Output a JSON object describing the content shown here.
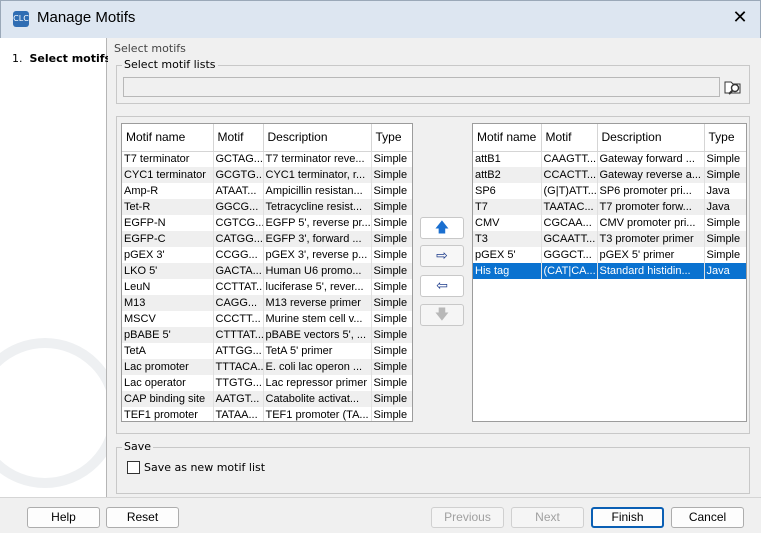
{
  "window": {
    "title": "Manage Motifs",
    "close": "✕",
    "app_icon": "CLC"
  },
  "steps": [
    {
      "num": "1.",
      "label": "Select motifs"
    }
  ],
  "section_title": "Select motifs",
  "motif_lists": {
    "label": "Select motif lists",
    "value": "",
    "browse_icon": "folder-search-icon"
  },
  "columns": [
    "Motif name",
    "Motif",
    "Description",
    "Type"
  ],
  "left_rows": [
    [
      "T7 terminator",
      "GCTAG...",
      "T7 terminator reve...",
      "Simple"
    ],
    [
      "CYC1 terminator",
      "GCGTG...",
      "CYC1 terminator, r...",
      "Simple"
    ],
    [
      "Amp-R",
      "ATAAT...",
      "Ampicillin resistan...",
      "Simple"
    ],
    [
      "Tet-R",
      "GGCG...",
      "Tetracycline resist...",
      "Simple"
    ],
    [
      "EGFP-N",
      "CGTCG...",
      "EGFP 5', reverse pr...",
      "Simple"
    ],
    [
      "EGFP-C",
      "CATGG...",
      "EGFP 3', forward ...",
      "Simple"
    ],
    [
      "pGEX 3'",
      "CCGG...",
      "pGEX 3', reverse p...",
      "Simple"
    ],
    [
      "LKO 5'",
      "GACTA...",
      "Human U6 promo...",
      "Simple"
    ],
    [
      "LeuN",
      "CCTTAT...",
      "luciferase 5', rever...",
      "Simple"
    ],
    [
      "M13",
      "CAGG...",
      "M13 reverse primer",
      "Simple"
    ],
    [
      "MSCV",
      "CCCTT...",
      "Murine stem cell v...",
      "Simple"
    ],
    [
      "pBABE 5'",
      "CTTTAT...",
      "pBABE vectors 5', ...",
      "Simple"
    ],
    [
      "TetA",
      "ATTGG...",
      "TetA 5' primer",
      "Simple"
    ],
    [
      "Lac promoter",
      "TTTACA...",
      "E. coli lac operon ...",
      "Simple"
    ],
    [
      "Lac operator",
      "TTGTG...",
      "Lac repressor primer",
      "Simple"
    ],
    [
      "CAP binding site",
      "AATGT...",
      "Catabolite activat...",
      "Simple"
    ],
    [
      "TEF1 promoter",
      "TATAA...",
      "TEF1 promoter (TA...",
      "Simple"
    ]
  ],
  "right_rows": [
    [
      "attB1",
      "CAAGTT...",
      "Gateway forward ...",
      "Simple"
    ],
    [
      "attB2",
      "CCACTT...",
      "Gateway reverse a...",
      "Simple"
    ],
    [
      "SP6",
      "(G|T)ATT...",
      "SP6 promoter pri...",
      "Java"
    ],
    [
      "T7",
      "TAATAC...",
      "T7 promoter forw...",
      "Java"
    ],
    [
      "CMV",
      "CGCAA...",
      "CMV promoter pri...",
      "Simple"
    ],
    [
      "T3",
      "GCAATT...",
      "T3 promoter primer",
      "Simple"
    ],
    [
      "pGEX 5'",
      "GGGCT...",
      "pGEX 5' primer",
      "Simple"
    ],
    [
      "His tag",
      "(CAT|CA...",
      "Standard histidin...",
      "Java"
    ]
  ],
  "selected_right_row": 7,
  "move_buttons": {
    "up": "🡅",
    "add": "⇨",
    "remove": "⇦",
    "down": "🡇"
  },
  "save": {
    "group": "Save",
    "checkbox_label": "Save as new motif list",
    "checked": false
  },
  "buttons": {
    "help": "Help",
    "reset": "Reset",
    "previous": "Previous",
    "next": "Next",
    "finish": "Finish",
    "cancel": "Cancel"
  }
}
